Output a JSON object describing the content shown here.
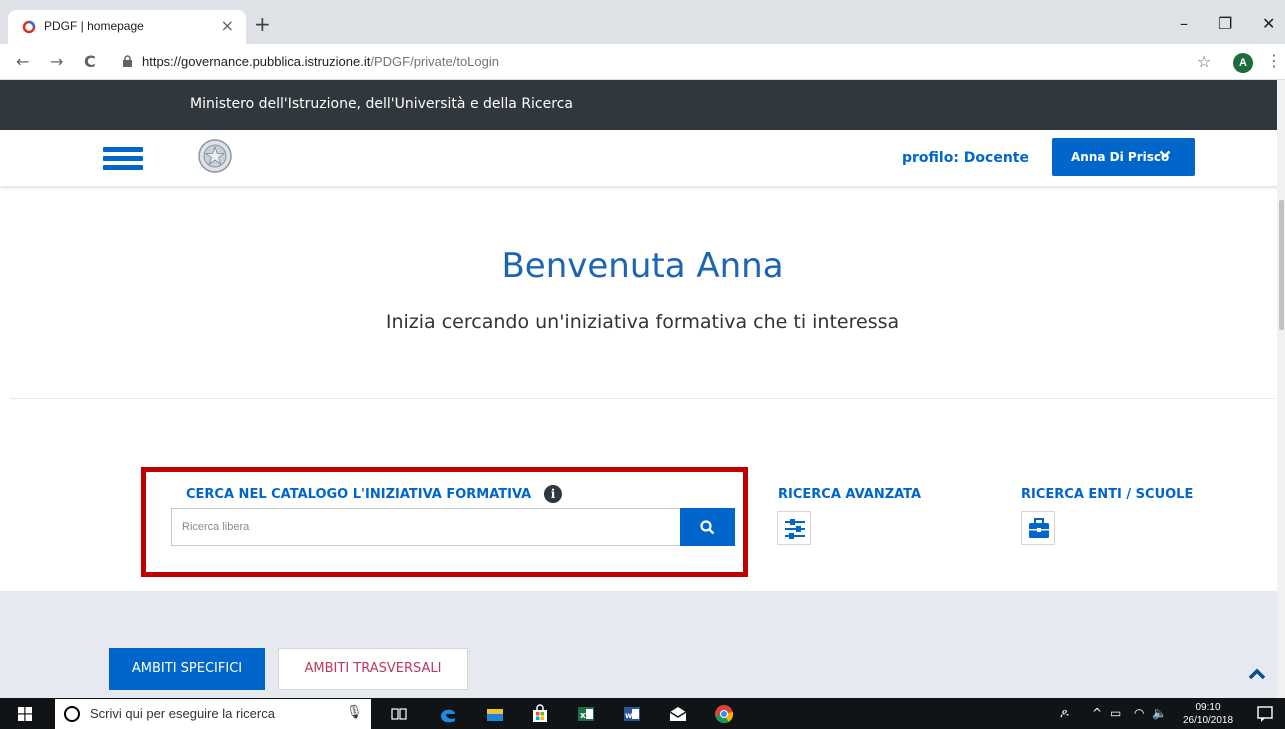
{
  "browser": {
    "tab_title": "PDGF | homepage",
    "tab_close": "×",
    "new_tab": "+",
    "url_host": "https://governance.pubblica.istruzione.it",
    "url_path": "/PDGF/private/toLogin",
    "profile_initial": "A",
    "minimize": "–",
    "restore": "❐",
    "close": "✕",
    "back": "←",
    "forward": "→",
    "reload": "C",
    "star": "☆",
    "menu": "⋮"
  },
  "site": {
    "ministry": "Ministero dell'Istruzione, dell'Università e della Ricerca",
    "profilo": "profilo: Docente",
    "user_name": "Anna Di Prisco"
  },
  "hero": {
    "title": "Benvenuta Anna",
    "subtitle": "Inizia cercando un'iniziativa formativa che ti interessa"
  },
  "search": {
    "label": "CERCA NEL CATALOGO L'INIZIATIVA FORMATIVA",
    "info": "i",
    "placeholder": "Ricerca libera",
    "advanced": "RICERCA AVANZATA",
    "enti": "RICERCA ENTI / SCUOLE"
  },
  "tabs": {
    "specifici": "AMBITI SPECIFICI",
    "trasversali": "AMBITI TRASVERSALI"
  },
  "taskbar": {
    "search_text": "Scrivi qui per eseguire la ricerca",
    "time": "09:10",
    "date": "26/10/2018"
  },
  "colors": {
    "accent": "#0066cc",
    "ministry_bar": "#30373d",
    "highlight_border": "#c00000",
    "trasversali_text": "#c0365a"
  },
  "icons": [
    "hamburger-icon",
    "emblem-icon",
    "chevron-down-icon",
    "info-icon",
    "search-icon",
    "sliders-icon",
    "briefcase-icon",
    "chevron-up-icon"
  ]
}
